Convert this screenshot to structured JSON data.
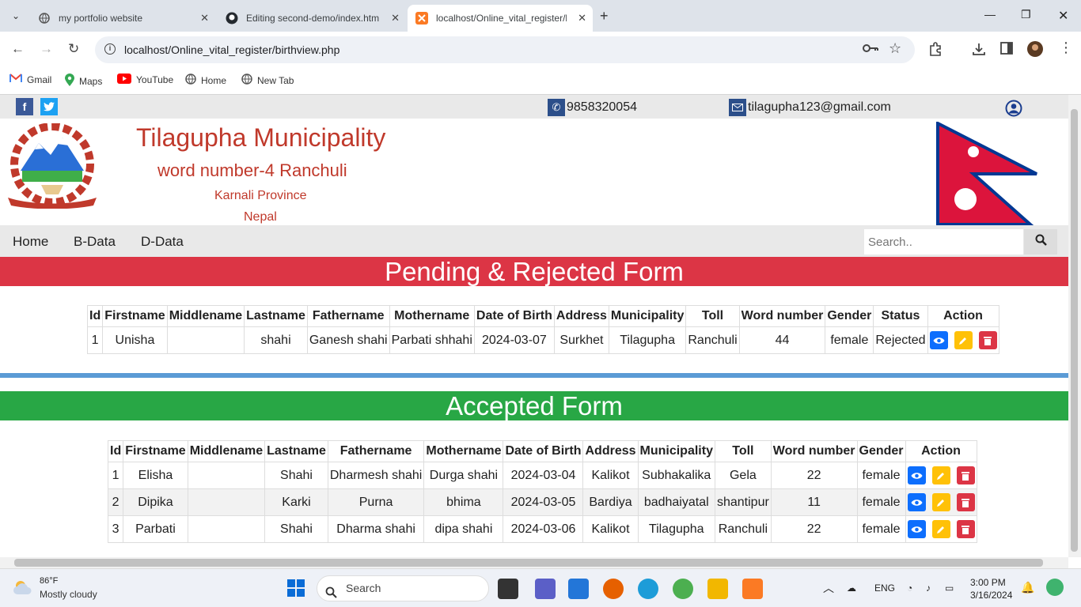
{
  "browser": {
    "tabs": [
      {
        "title": "my portfolio website",
        "active": false
      },
      {
        "title": "Editing second-demo/index.htm",
        "active": false
      },
      {
        "title": "localhost/Online_vital_register/b",
        "active": true
      }
    ],
    "url": "localhost/Online_vital_register/birthview.php",
    "bookmarks": [
      "Gmail",
      "Maps",
      "YouTube",
      "Home",
      "New Tab"
    ]
  },
  "site": {
    "phone": "9858320054",
    "email": "tilagupha123@gmail.com",
    "title": "Tilagupha Municipality",
    "subtitle": "word number-4 Ranchuli",
    "province": "Karnali Province",
    "country": "Nepal",
    "menu": [
      "Home",
      "B-Data",
      "D-Data"
    ],
    "search_placeholder": "Search.."
  },
  "pending": {
    "heading": "Pending & Rejected Form",
    "color": "#dc3545",
    "columns": [
      "Id",
      "Firstname",
      "Middlename",
      "Lastname",
      "Fathername",
      "Mothername",
      "Date of Birth",
      "Address",
      "Municipality",
      "Toll",
      "Word number",
      "Gender",
      "Status",
      "Action"
    ],
    "rows": [
      [
        "1",
        "Unisha",
        "",
        "shahi",
        "Ganesh shahi",
        "Parbati shhahi",
        "2024-03-07",
        "Surkhet",
        "Tilagupha",
        "Ranchuli",
        "44",
        "female",
        "Rejected"
      ]
    ]
  },
  "accepted": {
    "heading": "Accepted Form",
    "color": "#28a745",
    "columns": [
      "Id",
      "Firstname",
      "Middlename",
      "Lastname",
      "Fathername",
      "Mothername",
      "Date of Birth",
      "Address",
      "Municipality",
      "Toll",
      "Word number",
      "Gender",
      "Action"
    ],
    "rows": [
      [
        "1",
        "Elisha",
        "",
        "Shahi",
        "Dharmesh shahi",
        "Durga shahi",
        "2024-03-04",
        "Kalikot",
        "Subhakalika",
        "Gela",
        "22",
        "female"
      ],
      [
        "2",
        "Dipika",
        "",
        "Karki",
        "Purna",
        "bhima",
        "2024-03-05",
        "Bardiya",
        "badhaiyatal",
        "shantipur",
        "11",
        "female"
      ],
      [
        "3",
        "Parbati",
        "",
        "Shahi",
        "Dharma shahi",
        "dipa shahi",
        "2024-03-06",
        "Kalikot",
        "Tilagupha",
        "Ranchuli",
        "22",
        "female"
      ]
    ]
  },
  "taskbar": {
    "weather_temp": "86°F",
    "weather_desc": "Mostly cloudy",
    "search_label": "Search",
    "lang": "ENG",
    "time": "3:00 PM",
    "date": "3/16/2024"
  }
}
